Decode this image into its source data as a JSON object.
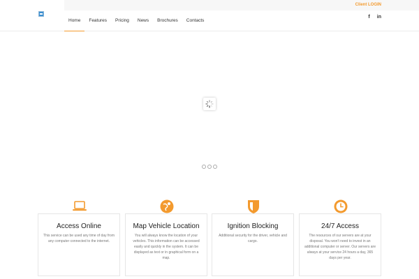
{
  "header": {
    "client_login": "Client LOGIN",
    "nav": [
      "Home",
      "Features",
      "Pricing",
      "News",
      "Brochures",
      "Contacts"
    ],
    "active_index": 0,
    "social": [
      {
        "icon": "facebook-icon",
        "glyph": "f"
      },
      {
        "icon": "linkedin-icon",
        "glyph": "in"
      }
    ]
  },
  "slider": {
    "slide_count": 3,
    "active_slide": 0
  },
  "features": [
    {
      "title": "Access Online",
      "icon": "laptop-icon",
      "text": "This service can be used any time of day from any computer connected to the internet."
    },
    {
      "title": "Map Vehicle Location",
      "icon": "globe-pin-icon",
      "text": "You will always know the location of your vehicles. This information can be accessed easily and quickly in the system. It can be displayed as text or in graphical form on a map."
    },
    {
      "title": "Ignition Blocking",
      "icon": "shield-icon",
      "text": "Additional security for the driver, vehicle and cargo."
    },
    {
      "title": "24/7 Access",
      "icon": "clock-icon",
      "text": "The resources of our servers are at your disposal. You won't need to invest in an additional computer or server. Our servers are always at your service 24 hours a day, 365 days per year."
    }
  ],
  "colors": {
    "accent": "#f39a2e",
    "logo": "#3d8fd0"
  }
}
